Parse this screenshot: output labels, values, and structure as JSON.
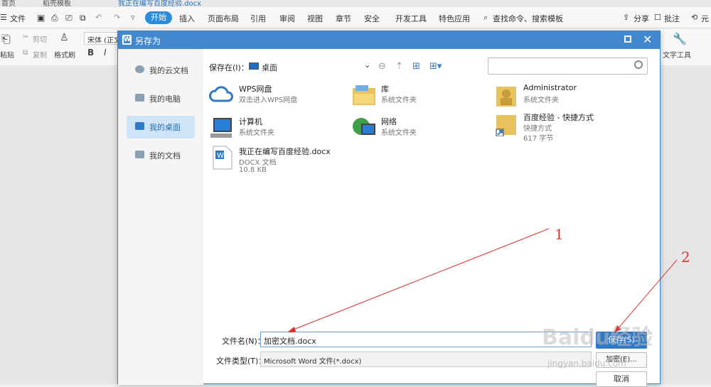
{
  "tabs": {
    "home": "首页",
    "template": "稻壳模板",
    "doc": "我正在编写百度经验.docx"
  },
  "menu": {
    "file": "文件",
    "start": "开始",
    "insert": "插入",
    "layout": "页面布局",
    "reference": "引用",
    "review": "审阅",
    "view": "视图",
    "chapter": "章节",
    "security": "安全",
    "devtools": "开发工具",
    "special": "特色应用",
    "search": "查找命令、搜索模板",
    "share": "分享",
    "annotate": "批注",
    "more": "元"
  },
  "ribbon": {
    "paste": "粘贴",
    "cut": "剪切",
    "copy": "复制",
    "format_painter": "格式刷",
    "font": "宋体 (正文",
    "bold": "B",
    "italic": "I",
    "text_tools": "文字工具"
  },
  "dialog": {
    "title": "另存为",
    "sidebar": [
      {
        "label": "我的云文档",
        "icon": "cloud-doc-icon"
      },
      {
        "label": "我的电脑",
        "icon": "computer-icon"
      },
      {
        "label": "我的桌面",
        "icon": "desktop-icon",
        "selected": true
      },
      {
        "label": "我的文档",
        "icon": "folder-icon"
      }
    ],
    "path_label": "保存在(I)：",
    "path_value": "桌面",
    "files": [
      {
        "name": "WPS网盘",
        "sub": "双击进入WPS网盘",
        "icon": "cloud-icon"
      },
      {
        "name": "库",
        "sub": "系统文件夹",
        "icon": "library-icon"
      },
      {
        "name": "Administrator",
        "sub": "系统文件夹",
        "icon": "user-folder-icon"
      },
      {
        "name": "计算机",
        "sub": "系统文件夹",
        "icon": "computer-icon"
      },
      {
        "name": "网络",
        "sub": "系统文件夹",
        "icon": "network-icon"
      },
      {
        "name": "百度经验 - 快捷方式",
        "sub": "快捷方式",
        "sub2": "617 字节",
        "icon": "shortcut-icon"
      },
      {
        "name": "我正在编写百度经验.docx",
        "sub": "DOCX 文档",
        "sub2": "10.8 KB",
        "icon": "docx-icon"
      }
    ],
    "filename_label": "文件名(N)：",
    "filename_value": "加密文档.docx",
    "filetype_label": "文件类型(T)：",
    "filetype_value": "Microsoft Word 文件(*.docx)",
    "save_button": "保存(S)",
    "encrypt_button": "加密(E)...",
    "cancel_button": "取消"
  },
  "annotations": {
    "one": "1",
    "two": "2"
  },
  "watermark": {
    "text": "Baidu经验",
    "url": "jingyan.baidu.com"
  }
}
